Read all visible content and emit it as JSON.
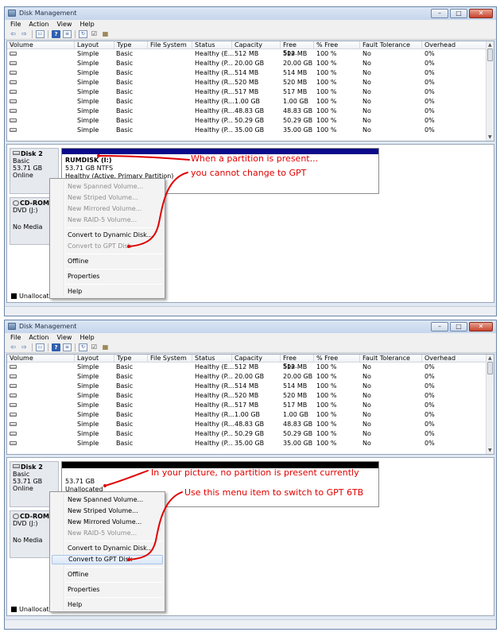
{
  "window_title": "Disk Management",
  "menu": [
    "File",
    "Action",
    "View",
    "Help"
  ],
  "caption_buttons": [
    "minimize",
    "maximize",
    "close"
  ],
  "toolbar_icons": [
    "back-arrow-icon",
    "forward-arrow-icon",
    "console-tree-icon",
    "help-icon",
    "properties-list-icon",
    "refresh-icon",
    "rescan-icon",
    "settings-grid-icon"
  ],
  "columns": [
    "Volume",
    "Layout",
    "Type",
    "File System",
    "Status",
    "Capacity",
    "Free Spa...",
    "% Free",
    "Fault Tolerance",
    "Overhead"
  ],
  "volumes": [
    {
      "layout": "Simple",
      "type": "Basic",
      "fs": "",
      "status": "Healthy (E...",
      "capacity": "512 MB",
      "free": "512 MB",
      "pct": "100 %",
      "fault": "No",
      "overhead": "0%"
    },
    {
      "layout": "Simple",
      "type": "Basic",
      "fs": "",
      "status": "Healthy (P...",
      "capacity": "20.00 GB",
      "free": "20.00 GB",
      "pct": "100 %",
      "fault": "No",
      "overhead": "0%"
    },
    {
      "layout": "Simple",
      "type": "Basic",
      "fs": "",
      "status": "Healthy (R...",
      "capacity": "514 MB",
      "free": "514 MB",
      "pct": "100 %",
      "fault": "No",
      "overhead": "0%"
    },
    {
      "layout": "Simple",
      "type": "Basic",
      "fs": "",
      "status": "Healthy (R...",
      "capacity": "520 MB",
      "free": "520 MB",
      "pct": "100 %",
      "fault": "No",
      "overhead": "0%"
    },
    {
      "layout": "Simple",
      "type": "Basic",
      "fs": "",
      "status": "Healthy (R...",
      "capacity": "517 MB",
      "free": "517 MB",
      "pct": "100 %",
      "fault": "No",
      "overhead": "0%"
    },
    {
      "layout": "Simple",
      "type": "Basic",
      "fs": "",
      "status": "Healthy (R...",
      "capacity": "1.00 GB",
      "free": "1.00 GB",
      "pct": "100 %",
      "fault": "No",
      "overhead": "0%"
    },
    {
      "layout": "Simple",
      "type": "Basic",
      "fs": "",
      "status": "Healthy (R...",
      "capacity": "48.83 GB",
      "free": "48.83 GB",
      "pct": "100 %",
      "fault": "No",
      "overhead": "0%"
    },
    {
      "layout": "Simple",
      "type": "Basic",
      "fs": "",
      "status": "Healthy (P...",
      "capacity": "50.29 GB",
      "free": "50.29 GB",
      "pct": "100 %",
      "fault": "No",
      "overhead": "0%"
    },
    {
      "layout": "Simple",
      "type": "Basic",
      "fs": "",
      "status": "Healthy (P...",
      "capacity": "35.00 GB",
      "free": "35.00 GB",
      "pct": "100 %",
      "fault": "No",
      "overhead": "0%"
    }
  ],
  "disk2": {
    "name": "Disk 2",
    "type": "Basic",
    "size": "53.71 GB",
    "state": "Online"
  },
  "cdrom": {
    "name": "CD-ROM",
    "drive": "DVD (J:)",
    "media": "No Media"
  },
  "legend_unallocated": "Unallocate",
  "context_menu": {
    "items": [
      "New Spanned Volume...",
      "New Striped Volume...",
      "New Mirrored Volume...",
      "New RAID-5 Volume...",
      "Convert to Dynamic Disk...",
      "Convert to GPT Disk",
      "Offline",
      "Properties",
      "Help"
    ]
  },
  "panel1": {
    "partition_name": "RUMDISK (I:)",
    "partition_size_fs": "53.71 GB NTFS",
    "partition_status": "Healthy (Active, Primary Partition)",
    "annotation_1": "When a partition is present...",
    "annotation_2": "you cannot change to GPT"
  },
  "panel2": {
    "partition_size": "53.71 GB",
    "partition_state": "Unallocated",
    "annotation_1": "In your picture, no partition is present currently",
    "annotation_2": "Use this menu item to switch to GPT 6TB"
  },
  "colors": {
    "annotation": "#e00000",
    "primary_partition": "#0a0a8a",
    "unallocated": "#000000"
  }
}
